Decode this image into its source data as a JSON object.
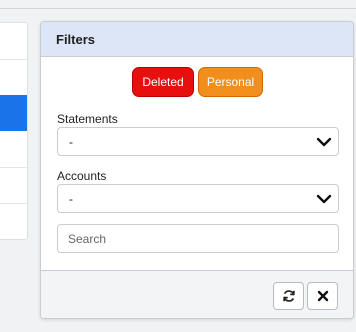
{
  "panel": {
    "title": "Filters",
    "tags": [
      {
        "label": "Deleted",
        "color": "#e8100f"
      },
      {
        "label": "Personal",
        "color": "#f28f1c"
      }
    ],
    "statements": {
      "label": "Statements",
      "value": "-"
    },
    "accounts": {
      "label": "Accounts",
      "value": "-"
    },
    "search": {
      "placeholder": "Search"
    },
    "footer": {
      "icons": [
        "refresh-icon",
        "close-icon"
      ]
    }
  },
  "colors": {
    "header_bg": "#dde6f7",
    "accent": "#1a73e8"
  }
}
